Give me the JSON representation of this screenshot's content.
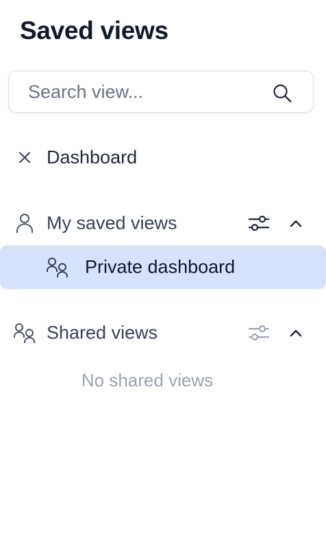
{
  "header": {
    "title": "Saved views"
  },
  "search": {
    "placeholder": "Search view...",
    "value": "",
    "icon": "search-icon"
  },
  "dashboard": {
    "label": "Dashboard",
    "icon": "close-icon"
  },
  "my_saved_views": {
    "label": "My saved views",
    "icon": "user-icon",
    "filter_icon": "sliders-icon",
    "toggle_icon": "chevron-up-icon",
    "items": [
      {
        "label": "Private dashboard",
        "icon": "users-icon",
        "selected": true
      }
    ]
  },
  "shared_views": {
    "label": "Shared views",
    "icon": "users-icon",
    "filter_icon": "sliders-icon",
    "toggle_icon": "chevron-up-icon",
    "empty_text": "No shared views"
  },
  "colors": {
    "selected_bg": "#d7e3fb",
    "muted_text": "#9ca3af",
    "title_text": "#111827",
    "border": "#d7dbe0"
  }
}
